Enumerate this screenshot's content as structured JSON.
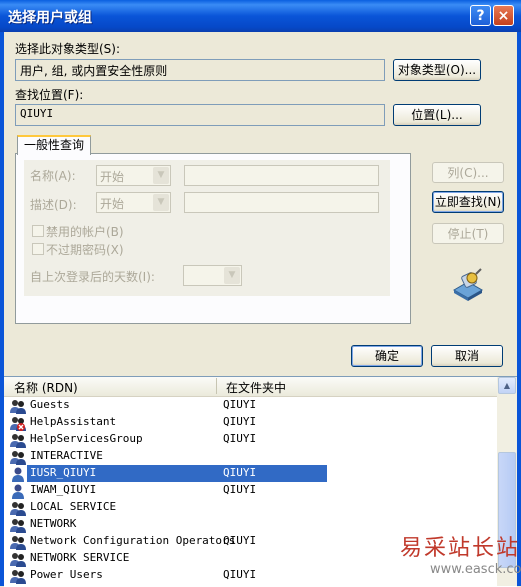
{
  "window": {
    "title": "选择用户或组",
    "help": "?",
    "close": "×"
  },
  "object_type": {
    "label": "选择此对象类型(S):",
    "value": "用户, 组, 或内置安全性原则",
    "button": "对象类型(O)..."
  },
  "location": {
    "label": "查找位置(F):",
    "value": "QIUYI",
    "button": "位置(L)..."
  },
  "tab": {
    "label": "一般性查询"
  },
  "query": {
    "name_label": "名称(A):",
    "name_mode": "开始",
    "desc_label": "描述(D):",
    "desc_mode": "开始",
    "disabled_accounts": "禁用的帐户(B)",
    "no_expire_pw": "不过期密码(X)",
    "days_since_login": "自上次登录后的天数(I):"
  },
  "side_buttons": {
    "columns": "列(C)...",
    "find_now": "立即查找(N)",
    "stop": "停止(T)"
  },
  "dialog_buttons": {
    "ok": "确定",
    "cancel": "取消"
  },
  "results": {
    "headers": {
      "name": "名称 (RDN)",
      "folder": "在文件夹中"
    },
    "rows": [
      {
        "name": "Guests",
        "folder": "QIUYI",
        "icon": "group-icon"
      },
      {
        "name": "HelpAssistant",
        "folder": "QIUYI",
        "icon": "disabled-user-icon"
      },
      {
        "name": "HelpServicesGroup",
        "folder": "QIUYI",
        "icon": "group-icon"
      },
      {
        "name": "INTERACTIVE",
        "folder": "",
        "icon": "group-icon"
      },
      {
        "name": "IUSR_QIUYI",
        "folder": "QIUYI",
        "icon": "user-icon",
        "selected": true
      },
      {
        "name": "IWAM_QIUYI",
        "folder": "QIUYI",
        "icon": "user-icon"
      },
      {
        "name": "LOCAL SERVICE",
        "folder": "",
        "icon": "group-icon"
      },
      {
        "name": "NETWORK",
        "folder": "",
        "icon": "group-icon"
      },
      {
        "name": "Network Configuration Operators",
        "folder": "QIUYI",
        "icon": "group-icon"
      },
      {
        "name": "NETWORK SERVICE",
        "folder": "",
        "icon": "group-icon"
      },
      {
        "name": "Power Users",
        "folder": "QIUYI",
        "icon": "group-icon"
      }
    ]
  },
  "watermark": {
    "text": "易采站长站",
    "url": "www.easck.com"
  }
}
